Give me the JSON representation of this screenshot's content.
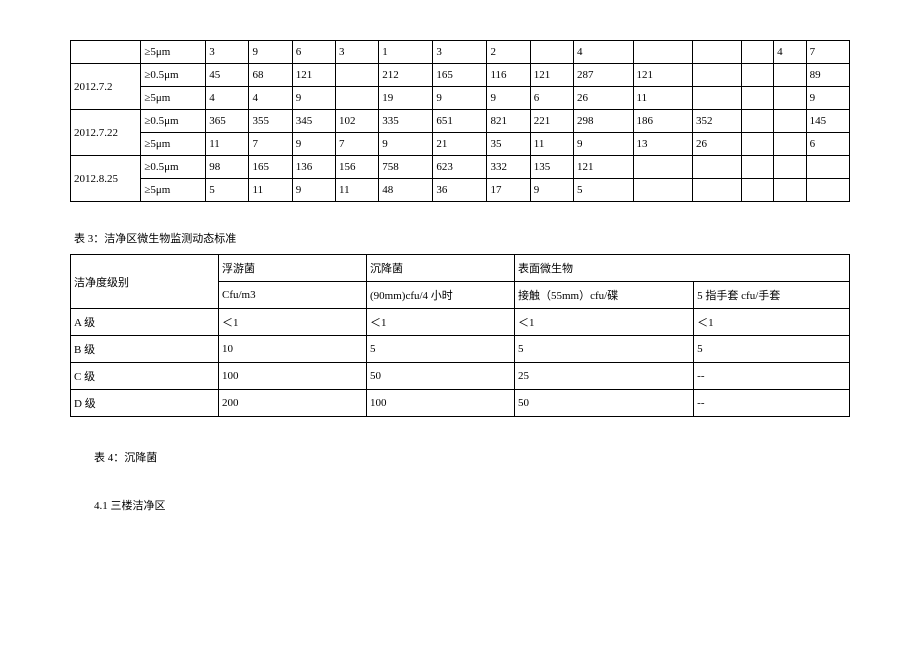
{
  "table1": {
    "rows": [
      {
        "date": "",
        "size": "≥5μm",
        "c": [
          "3",
          "9",
          "6",
          "3",
          "1",
          "3",
          "2",
          "",
          "4",
          "",
          "",
          "",
          "4",
          "7"
        ]
      },
      {
        "date": "2012.7.2",
        "size": "≥0.5μm",
        "c": [
          "45",
          "68",
          "121",
          "",
          "212",
          "165",
          "116",
          "121",
          "287",
          "121",
          "",
          "",
          "",
          "89"
        ]
      },
      {
        "date": "",
        "size": "≥5μm",
        "c": [
          "4",
          "4",
          "9",
          "",
          "19",
          "9",
          "9",
          "6",
          "26",
          "11",
          "",
          "",
          "",
          "9"
        ]
      },
      {
        "date": "2012.7.22",
        "size": "≥0.5μm",
        "c": [
          "365",
          "355",
          "345",
          "102",
          "335",
          "651",
          "821",
          "221",
          "298",
          "186",
          "352",
          "",
          "",
          "145"
        ]
      },
      {
        "date": "",
        "size": "≥5μm",
        "c": [
          "11",
          "7",
          "9",
          "7",
          "9",
          "21",
          "35",
          "11",
          "9",
          "13",
          "26",
          "",
          "",
          "6"
        ]
      },
      {
        "date": "2012.8.25",
        "size": "≥0.5μm",
        "c": [
          "98",
          "165",
          "136",
          "156",
          "758",
          "623",
          "332",
          "135",
          "121",
          "",
          "",
          "",
          "",
          ""
        ]
      },
      {
        "date": "",
        "size": "≥5μm",
        "c": [
          "5",
          "11",
          "9",
          "11",
          "48",
          "36",
          "17",
          "9",
          "5",
          "",
          "",
          "",
          "",
          ""
        ]
      }
    ]
  },
  "table2_caption": "表 3：洁净区微生物监测动态标准",
  "table2": {
    "header": {
      "h1": "洁净度级别",
      "h2_top": "浮游菌",
      "h2_bot": "Cfu/m3",
      "h3_top": "沉降菌",
      "h3_bot": "(90mm)cfu/4 小时",
      "h4_top": "表面微生物",
      "h4a_bot": "接触（55mm）cfu/碟",
      "h4b_bot": "5 指手套 cfu/手套"
    },
    "rows": [
      {
        "c": [
          "A 级",
          "＜1",
          "＜1",
          "＜1",
          "＜1"
        ]
      },
      {
        "c": [
          "B 级",
          "10",
          "5",
          "5",
          "5"
        ]
      },
      {
        "c": [
          "C 级",
          "100",
          "50",
          "25",
          "--"
        ]
      },
      {
        "c": [
          "D 级",
          "200",
          "100",
          "50",
          "--"
        ]
      }
    ]
  },
  "caption3": "表 4：沉降菌",
  "caption4": "4.1 三楼洁净区"
}
